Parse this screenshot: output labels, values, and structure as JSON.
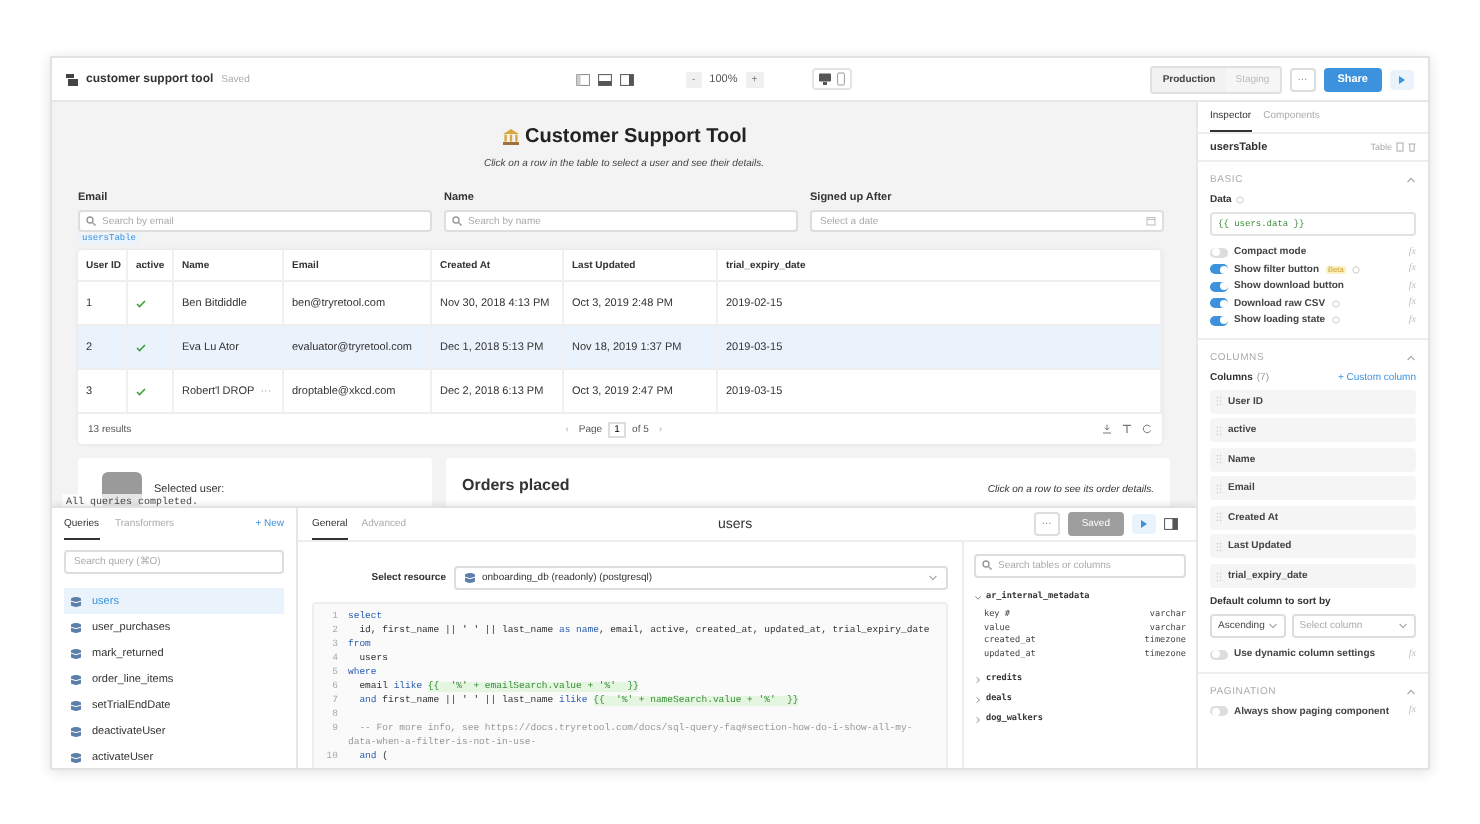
{
  "topbar": {
    "app_title": "customer support tool",
    "save_status": "Saved",
    "zoom": {
      "decrease": "-",
      "value": "100%",
      "increase": "+"
    },
    "environments": [
      {
        "label": "Production",
        "selected": true
      },
      {
        "label": "Staging",
        "selected": false
      }
    ],
    "more": "···",
    "share": "Share"
  },
  "canvas": {
    "title": "Customer Support Tool",
    "subtitle": "Click on a row in the table to select a user and see their details.",
    "filters": [
      {
        "label": "Email",
        "placeholder": "Search by email",
        "kind": "search"
      },
      {
        "label": "Name",
        "placeholder": "Search by name",
        "kind": "search"
      },
      {
        "label": "Signed up After",
        "placeholder": "Select a date",
        "kind": "date"
      }
    ],
    "table_tag": "usersTable",
    "table": {
      "columns": [
        "User ID",
        "active",
        "Name",
        "Email",
        "Created At",
        "Last Updated",
        "trial_expiry_date"
      ],
      "rows": [
        {
          "user_id": "1",
          "active": true,
          "name": "Ben Bitdiddle",
          "email": "ben@tryretool.com",
          "created_at": "Nov 30, 2018 4:13 PM",
          "last_updated": "Oct 3, 2019 2:48 PM",
          "trial_expiry_date": "2019-02-15",
          "selected": false
        },
        {
          "user_id": "2",
          "active": true,
          "name": "Eva Lu Ator",
          "email": "evaluator@tryretool.com",
          "created_at": "Dec 1, 2018 5:13 PM",
          "last_updated": "Nov 18, 2019 1:37 PM",
          "trial_expiry_date": "2019-03-15",
          "selected": true
        },
        {
          "user_id": "3",
          "active": true,
          "name": "Robert'l DROP",
          "overflow": "···",
          "email": "droptable@xkcd.com",
          "created_at": "Dec 2, 2018 6:13 PM",
          "last_updated": "Oct 3, 2019 2:47 PM",
          "trial_expiry_date": "2019-03-15",
          "selected": false
        }
      ],
      "results": "13 results",
      "pagination": {
        "prev": "‹",
        "page_label": "Page",
        "page": "1",
        "of": "of 5",
        "next": "›"
      }
    },
    "user_card": {
      "label": "Selected user:"
    },
    "orders_card": {
      "title": "Orders placed",
      "hint": "Click on a row to see its order details."
    },
    "toast": "All queries completed."
  },
  "query_panel": {
    "tabs": [
      {
        "label": "Queries",
        "selected": true
      },
      {
        "label": "Transformers",
        "selected": false
      }
    ],
    "new": "+ New",
    "search_placeholder": "Search query (⌘O)",
    "queries": [
      {
        "name": "users",
        "selected": true
      },
      {
        "name": "user_purchases",
        "selected": false
      },
      {
        "name": "mark_returned",
        "selected": false
      },
      {
        "name": "order_line_items",
        "selected": false
      },
      {
        "name": "setTrialEndDate",
        "selected": false
      },
      {
        "name": "deactivateUser",
        "selected": false
      },
      {
        "name": "activateUser",
        "selected": false
      }
    ],
    "editor_tabs": [
      {
        "label": "General",
        "selected": true
      },
      {
        "label": "Advanced",
        "selected": false
      }
    ],
    "query_title": "users",
    "more": "···",
    "save": {
      "label": "Saved",
      "disabled": true
    },
    "resource_label": "Select resource",
    "resource": "onboarding_db (readonly) (postgresql)",
    "code": [
      {
        "number": "1",
        "tokens": [
          {
            "kind": "keyword",
            "text": "select"
          }
        ]
      },
      {
        "number": "2",
        "tokens": [
          {
            "kind": "plain",
            "text": "  id, first_name || ' ' || last_name "
          },
          {
            "kind": "keyword",
            "text": "as name"
          },
          {
            "kind": "plain",
            "text": ", email, active, created_at, updated_at, trial_expiry_date"
          }
        ]
      },
      {
        "number": "3",
        "tokens": [
          {
            "kind": "keyword",
            "text": "from"
          }
        ]
      },
      {
        "number": "4",
        "tokens": [
          {
            "kind": "plain",
            "text": "  users"
          }
        ]
      },
      {
        "number": "5",
        "tokens": [
          {
            "kind": "keyword",
            "text": "where"
          }
        ]
      },
      {
        "number": "6",
        "tokens": [
          {
            "kind": "plain",
            "text": "  email "
          },
          {
            "kind": "keyword",
            "text": "ilike "
          },
          {
            "kind": "template",
            "text": "{{  '%' + emailSearch.value + '%'  }}"
          }
        ]
      },
      {
        "number": "7",
        "tokens": [
          {
            "kind": "keyword",
            "text": "  and"
          },
          {
            "kind": "plain",
            "text": " first_name || ' ' || last_name "
          },
          {
            "kind": "keyword",
            "text": "ilike "
          },
          {
            "kind": "template",
            "text": "{{  '%' + nameSearch.value + '%'  }}"
          }
        ]
      },
      {
        "number": "8"
      },
      {
        "number": "9",
        "tokens": [
          {
            "kind": "comment",
            "text": "  -- For more info, see https://docs.tryretool.com/docs/sql-query-faq#section-how-do-i-show-all-my-"
          }
        ]
      },
      {
        "tokens": [
          {
            "kind": "comment",
            "text": "data-when-a-filter-is-not-in-use-"
          }
        ]
      },
      {
        "number": "10",
        "tokens": [
          {
            "kind": "keyword",
            "text": "  and"
          },
          {
            "kind": "plain",
            "text": " ("
          }
        ]
      }
    ],
    "schema": {
      "search_placeholder": "Search tables or columns",
      "tables": [
        {
          "name": "ar_internal_metadata",
          "expanded": true,
          "columns": [
            {
              "name": "key #",
              "type": "varchar"
            },
            {
              "name": "value",
              "type": "varchar"
            },
            {
              "name": "created_at",
              "type": "timezone"
            },
            {
              "name": "updated_at",
              "type": "timezone"
            }
          ]
        },
        {
          "name": "credits",
          "expanded": false
        },
        {
          "name": "deals",
          "expanded": false
        },
        {
          "name": "dog_walkers",
          "expanded": false
        }
      ]
    }
  },
  "inspector": {
    "tabs": [
      {
        "label": "Inspector",
        "selected": true
      },
      {
        "label": "Components",
        "selected": false
      }
    ],
    "component_name": "usersTable",
    "component_type": "Table",
    "basic": {
      "title": "BASIC",
      "data_label": "Data",
      "data_value": "{{ users.data }}",
      "options": [
        {
          "label": "Compact mode",
          "on": false,
          "info": false,
          "formula": "fx"
        },
        {
          "label": "Show filter button",
          "on": true,
          "badge": "Beta",
          "info": true,
          "formula": "fx"
        },
        {
          "label": "Show download button",
          "on": true,
          "info": false,
          "formula": "fx"
        },
        {
          "label": "Download raw CSV",
          "on": true,
          "info": true,
          "formula": "fx"
        },
        {
          "label": "Show loading state",
          "on": true,
          "info": true,
          "formula": "fx"
        }
      ]
    },
    "columns": {
      "title": "COLUMNS",
      "label": "Columns",
      "count": "(7)",
      "add": "+ Custom column",
      "items": [
        "User ID",
        "active",
        "Name",
        "Email",
        "Created At",
        "Last Updated",
        "trial_expiry_date"
      ],
      "sort_label": "Default column to sort by",
      "sort_order": "Ascending",
      "sort_column_placeholder": "Select column",
      "options": [
        {
          "label": "Use dynamic column settings",
          "on": false,
          "info": false,
          "formula": "fx"
        }
      ]
    },
    "pagination": {
      "title": "PAGINATION",
      "options": [
        {
          "label": "Always show paging component",
          "on": false,
          "info": false,
          "formula": "fx"
        }
      ]
    }
  }
}
